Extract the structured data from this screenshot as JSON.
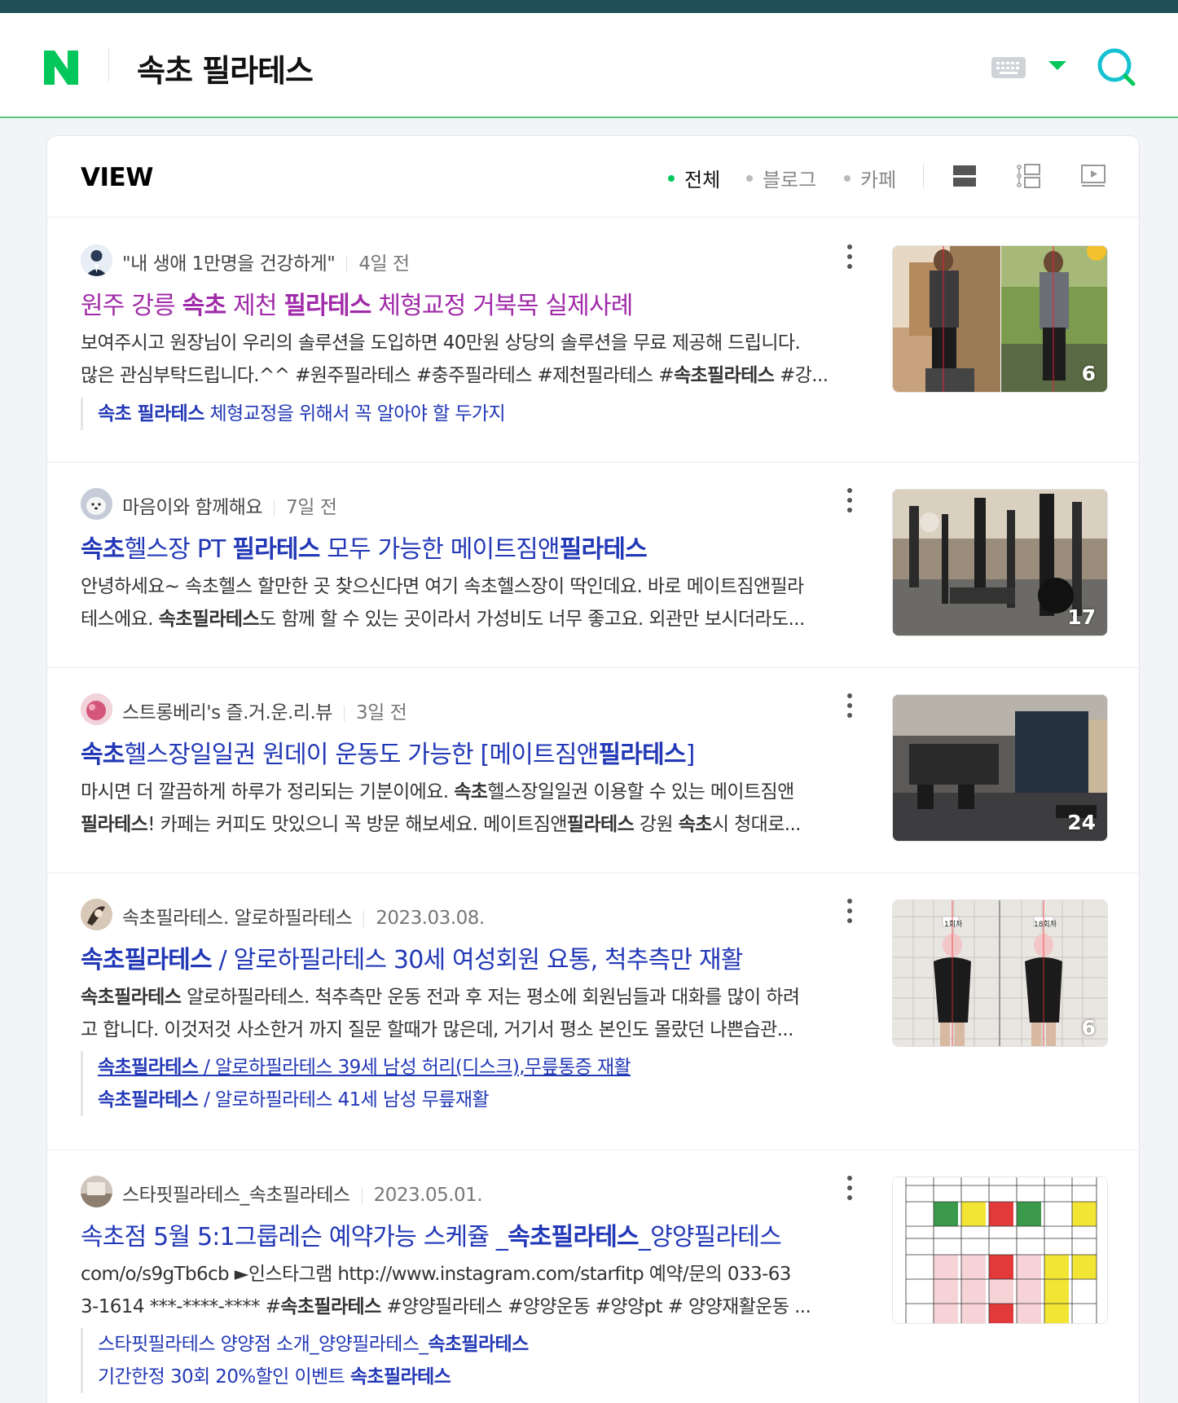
{
  "search": {
    "query": "속초 필라테스"
  },
  "colors": {
    "brand_green": "#03c75a",
    "link_blue": "#2238b6",
    "visited_purple": "#a02ba8"
  },
  "view": {
    "title": "VIEW",
    "filters": [
      {
        "label": "전체",
        "active": true
      },
      {
        "label": "블로그",
        "active": false
      },
      {
        "label": "카페",
        "active": false
      }
    ],
    "icons": [
      "list-large-icon",
      "list-detail-icon",
      "video-icon"
    ]
  },
  "results": [
    {
      "author": "\"내 생애 1만명을 건강하게\"",
      "time": "4일 전",
      "title_parts": [
        "원주 강릉 ",
        "속초",
        " 제천 ",
        "필라테스",
        " 체형교정 거북목 실제사례"
      ],
      "desc_line1": [
        "보여주시고 원장님이 우리의 솔루션을 도입하면 40만원 상당의 솔루션을 무료 제공해 드립니다."
      ],
      "desc_line2": [
        "많은 관심부탁드립니다.^^ #원주필라테스 #충주필라테스 #제천필라테스 #",
        "속초필라테스",
        " #강..."
      ],
      "sub_links": [
        {
          "parts": [
            "속초 필라테스",
            " 체형교정을 위해서 꼭 알아야 할 두가지"
          ]
        }
      ],
      "image_count": "6"
    },
    {
      "author": "마음이와 함께해요",
      "time": "7일 전",
      "title_parts": [
        "속초",
        "헬스장 PT ",
        "필라테스",
        " 모두 가능한 메이트짐앤",
        "필라테스"
      ],
      "desc_line1": [
        "안녕하세요~ 속초헬스 할만한 곳 찾으신다면 여기 속초헬스장이 딱인데요. 바로 메이트짐앤필라"
      ],
      "desc_line2": [
        "테스에요. ",
        "속초필라테스",
        "도 함께 할 수 있는 곳이라서 가성비도 너무 좋고요. 외관만 보시더라도..."
      ],
      "sub_links": [],
      "image_count": "17"
    },
    {
      "author": "스트롱베리's 즐.거.운.리.뷰",
      "time": "3일 전",
      "title_parts": [
        "속초",
        "헬스장일일권 원데이 운동도 가능한 [메이트짐앤",
        "필라테스",
        "]"
      ],
      "desc_line1": [
        "마시면 더 깔끔하게 하루가 정리되는 기분이에요. ",
        "속초",
        "헬스장일일권 이용할 수 있는 메이트짐앤"
      ],
      "desc_line2": [
        "필라테스",
        "! 카페는 커피도 맛있으니 꼭 방문 해보세요. 메이트짐앤",
        "필라테스",
        " 강원 ",
        "속초",
        "시 청대로..."
      ],
      "sub_links": [],
      "image_count": "24"
    },
    {
      "author": "속초필라테스. 알로하필라테스",
      "time": "2023.03.08.",
      "title_parts": [
        "속초필라테스",
        " / 알로하필라테스 30세 여성회원 요통, 척추측만 재활"
      ],
      "desc_line1": [
        "속초필라테스",
        " 알로하필라테스. 척추측만 운동 전과 후 저는 평소에 회원님들과 대화를 많이 하려"
      ],
      "desc_line2": [
        "고 합니다. 이것저것 사소한거 까지 질문 할때가 많은데, 거기서 평소 본인도 몰랐던 나쁜습관..."
      ],
      "sub_links": [
        {
          "parts": [
            "속초필라테스",
            " / 알로하필라테스 39세 남성 허리(디스크),무릎통증 재활"
          ]
        },
        {
          "parts": [
            "속초필라테스",
            " / 알로하필라테스 41세 남성 무릎재활"
          ]
        }
      ],
      "image_labels": [
        "1회차",
        "18회차"
      ],
      "image_count": "6"
    },
    {
      "author": "스타핏필라테스_속초필라테스",
      "time": "2023.05.01.",
      "title_parts": [
        "속초점 5월 5:1그룹레슨 예약가능 스케쥴 _",
        "속초필라테스",
        "_양양필라테스"
      ],
      "desc_line1": [
        "com/o/s9gTb6cb ►인스타그램 http://www.instagram.com/starfitp 예약/문의 033-63"
      ],
      "desc_line2": [
        "3-1614 ***-****-**** #",
        "속초필라테스",
        " #양양필라테스 #양양운동 #양양pt # 양양재활운동 ..."
      ],
      "sub_links": [
        {
          "parts": [
            "스타핏필라테스 양양점 소개_양양필라테스_",
            "속초필라테스"
          ]
        },
        {
          "parts": [
            "기간한정 30회 20%할인 이벤트 ",
            "속초필라테스"
          ]
        }
      ],
      "image_count": ""
    }
  ]
}
